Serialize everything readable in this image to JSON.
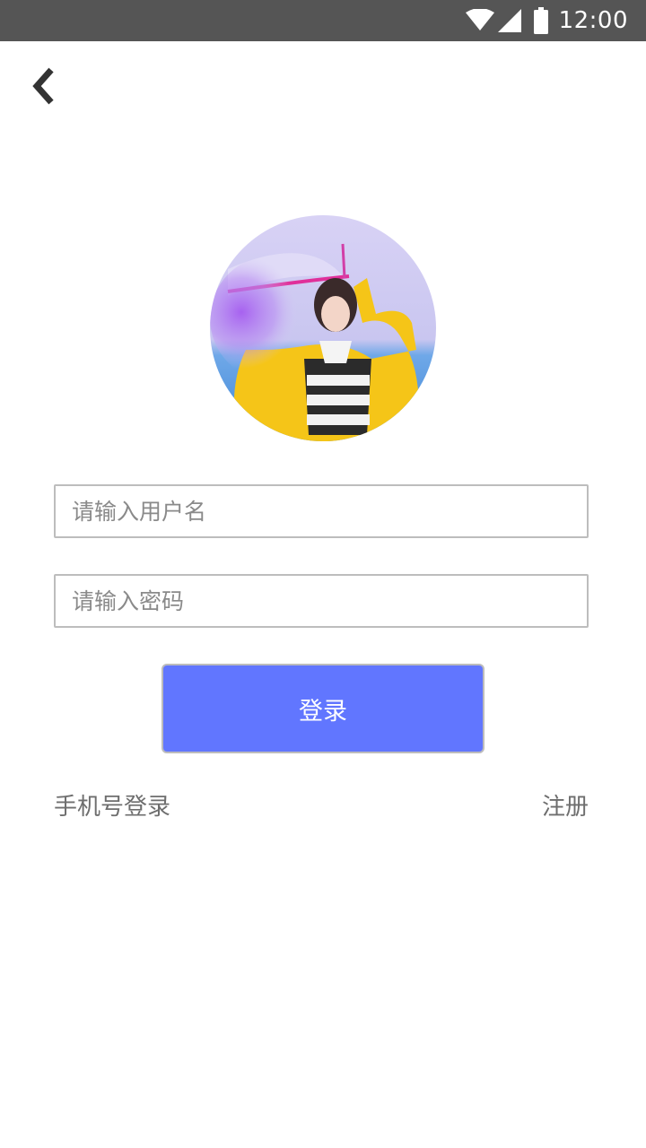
{
  "status_bar": {
    "time": "12:00",
    "icons": [
      "wifi-icon",
      "signal-icon",
      "battery-icon"
    ]
  },
  "nav": {
    "back_icon": "chevron-left-icon"
  },
  "avatar": {
    "description_icon": "avatar-photo"
  },
  "form": {
    "username_placeholder": "请输入用户名",
    "password_placeholder": "请输入密码",
    "login_label": "登录"
  },
  "links": {
    "phone_login": "手机号登录",
    "register": "注册"
  },
  "colors": {
    "status_bar": "#555555",
    "primary": "#6176ff",
    "input_border": "#bdbdbd",
    "link_text": "#6e6e6e"
  }
}
